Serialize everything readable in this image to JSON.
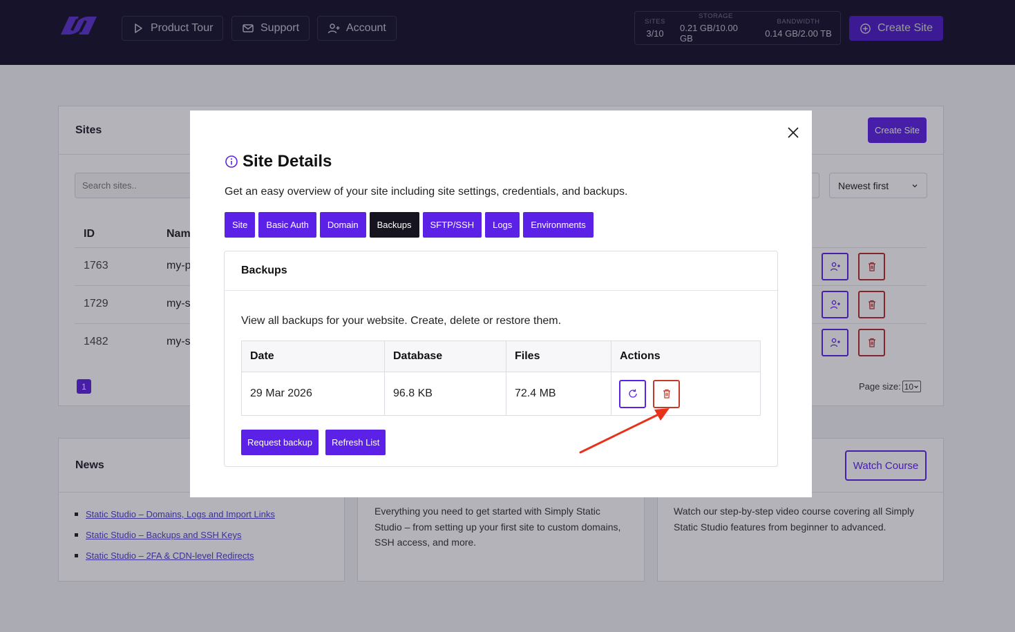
{
  "topbar": {
    "nav": [
      {
        "label": "Product Tour",
        "icon": "play-icon"
      },
      {
        "label": "Support",
        "icon": "mail-icon"
      },
      {
        "label": "Account",
        "icon": "user-plus-icon"
      }
    ],
    "stats": [
      {
        "label": "SITES",
        "value": "3/10"
      },
      {
        "label": "STORAGE",
        "value": "0.21 GB/10.00 GB"
      },
      {
        "label": "BANDWIDTH",
        "value": "0.14 GB/2.00 TB"
      }
    ],
    "create_site_label": "Create Site"
  },
  "sites": {
    "title": "Sites",
    "create_label": "Create Site",
    "search_placeholder": "Search sites..",
    "sort_value": "Newest first",
    "columns": [
      "ID",
      "Nam"
    ],
    "rows": [
      {
        "id": "1763",
        "name": "my-p"
      },
      {
        "id": "1729",
        "name": "my-s"
      },
      {
        "id": "1482",
        "name": "my-s"
      }
    ],
    "page": "1",
    "page_size_label": "Page size:",
    "page_size_value": "10"
  },
  "news": {
    "title": "News",
    "links": [
      "Static Studio – Domains, Logs and Import Links",
      "Static Studio – Backups and SSH Keys",
      "Static Studio – 2FA & CDN-level Redirects"
    ]
  },
  "guide": {
    "text": "Everything you need to get started with Simply Static Studio – from setting up your first site to custom domains, SSH access, and more."
  },
  "course": {
    "button": "Watch Course",
    "text": "Watch our step-by-step video course covering all Simply Static Studio features from beginner to advanced."
  },
  "modal": {
    "title": "Site Details",
    "description": "Get an easy overview of your site including site settings, credentials, and backups.",
    "tabs": [
      "Site",
      "Basic Auth",
      "Domain",
      "Backups",
      "SFTP/SSH",
      "Logs",
      "Environments"
    ],
    "active_tab": "Backups",
    "panel": {
      "title": "Backups",
      "description": "View all backups for your website. Create, delete or restore them.",
      "columns": [
        "Date",
        "Database",
        "Files",
        "Actions"
      ],
      "rows": [
        {
          "date": "29 Mar 2026",
          "database": "96.8 KB",
          "files": "72.4 MB"
        }
      ],
      "request_label": "Request backup",
      "refresh_label": "Refresh List"
    }
  },
  "colors": {
    "accent": "#5b21e6",
    "topbar": "#18152f",
    "danger": "#c0392b",
    "annotation": "#e8311a"
  }
}
